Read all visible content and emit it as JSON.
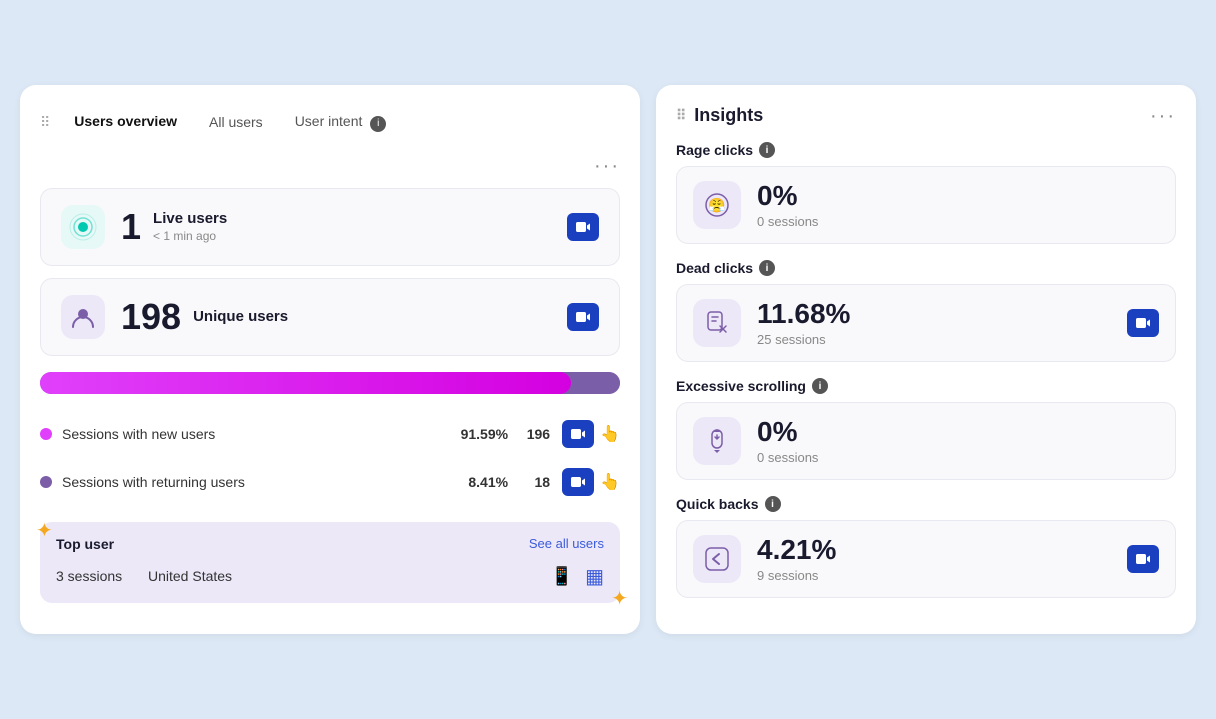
{
  "tabs": {
    "title": "Users overview",
    "items": [
      {
        "label": "Users overview",
        "active": true
      },
      {
        "label": "All users",
        "active": false
      },
      {
        "label": "User intent",
        "active": false,
        "info": true
      }
    ]
  },
  "live_users": {
    "count": "1",
    "label": "Live users",
    "subtitle": "< 1 min ago"
  },
  "unique_users": {
    "count": "198",
    "label": "Unique users"
  },
  "sessions": {
    "new_label": "Sessions with new users",
    "new_pct": "91.59%",
    "new_count": "196",
    "returning_label": "Sessions with returning users",
    "returning_pct": "8.41%",
    "returning_count": "18",
    "new_bar_width": "91.59",
    "returning_bar_width": "8.41"
  },
  "top_user": {
    "title": "Top user",
    "see_all": "See all users",
    "sessions": "3 sessions",
    "country": "United States"
  },
  "insights": {
    "title": "Insights",
    "rage_clicks": {
      "label": "Rage clicks",
      "value": "0%",
      "sessions": "0 sessions"
    },
    "dead_clicks": {
      "label": "Dead clicks",
      "value": "11.68%",
      "sessions": "25 sessions"
    },
    "excessive_scrolling": {
      "label": "Excessive scrolling",
      "value": "0%",
      "sessions": "0 sessions"
    },
    "quick_backs": {
      "label": "Quick backs",
      "value": "4.21%",
      "sessions": "9 sessions"
    }
  }
}
